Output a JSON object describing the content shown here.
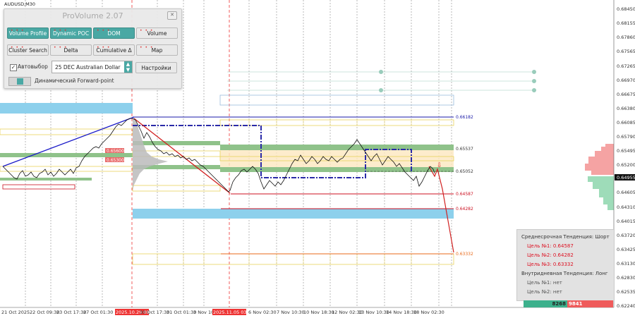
{
  "symbol": "AUDUSD,M30",
  "price_axis": {
    "ticks": [
      "0.68450",
      "0.68155",
      "0.67860",
      "0.67565",
      "0.67265",
      "0.66970",
      "0.66675",
      "0.66380",
      "0.66085",
      "0.65790",
      "0.65495",
      "0.65200",
      "0.64955",
      "0.64605",
      "0.64310",
      "0.64015",
      "0.63720",
      "0.63425",
      "0.63130",
      "0.62830",
      "0.62535",
      "0.62240"
    ],
    "current_price": "0.64955"
  },
  "time_axis": {
    "labels": [
      "21 Oct 2025",
      "22 Oct 09:30",
      "23 Oct 17:30",
      "27 Oct 01:30",
      "2025.10.29 08:30",
      "30 Oct 17:30",
      "31 Oct 01:30",
      "3 Nov 10:",
      "2025.11.05 03:00",
      "6 Nov 02:30",
      "7 Nov 10:30",
      "10 Nov 18:30",
      "12 Nov 02:30",
      "13 Nov 10:30",
      "14 Nov 18:30",
      "18 Nov 02:30"
    ],
    "highlighted": [
      "2025.10.29 08:30",
      "2025.11.05 03:00"
    ]
  },
  "levels": {
    "l1": "0.66182",
    "l2": "0.65537",
    "l3": "0.65052",
    "l4": "0.64587",
    "l5": "0.64282",
    "l6": "0.63332",
    "l7": "0.65600",
    "l8": "0.65300"
  },
  "panel": {
    "title": "ProVolume 2.07",
    "close": "✕",
    "buttons": [
      {
        "label": "Volume Profile",
        "on": true
      },
      {
        "label": "Dynamic POC",
        "on": true
      },
      {
        "label": "DOM",
        "on": true
      },
      {
        "label": "Volume",
        "on": false
      },
      {
        "label": "Cluster Search",
        "on": false
      },
      {
        "label": "Delta",
        "on": false
      },
      {
        "label": "Cumulative Δ",
        "on": false
      },
      {
        "label": "Map",
        "on": false
      }
    ],
    "autoselect_label": "Автовыбор",
    "autoselect_checked": "✓",
    "instrument": "25 DEC Australian Dollar",
    "settings_label": "Настройки",
    "forward_label": "Динамический Forward-point"
  },
  "trend_box": {
    "mid_title": "Среднесрочная Тенденция: Шорт",
    "target1": "Цель №1:  0.64587",
    "target2": "Цель №2:  0.64282",
    "target3": "Цель №3:  0.63332",
    "intra_title": "Внутридневная Тенденция: Лонг",
    "intra1": "Цель №1:  нет",
    "intra2": "Цель №2:  нет"
  },
  "volume_bar": {
    "buy": "8268",
    "sell": "9841"
  },
  "colors": {
    "accent": "#4aa8a4",
    "short": "#d12020",
    "long": "#3cb08c"
  }
}
